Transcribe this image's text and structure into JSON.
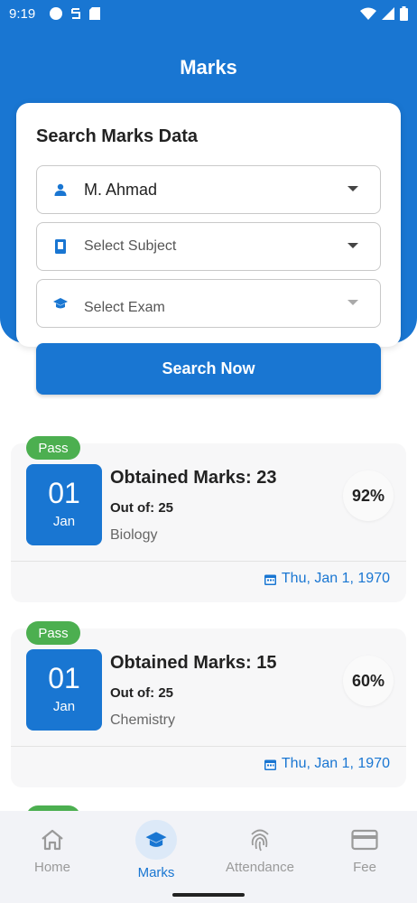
{
  "status_bar": {
    "time": "9:19"
  },
  "header": {
    "title": "Marks"
  },
  "search": {
    "title": "Search Marks Data",
    "student_value": "M. Ahmad",
    "subject_placeholder": "Select Subject",
    "exam_placeholder": "Select Exam",
    "button_label": "Search Now"
  },
  "marks": [
    {
      "status": "Pass",
      "day": "01",
      "month": "Jan",
      "obtained": "Obtained Marks: 23",
      "out_of": "Out of: 25",
      "subject": "Biology",
      "percent": "92%",
      "date": "Thu, Jan 1, 1970"
    },
    {
      "status": "Pass",
      "day": "01",
      "month": "Jan",
      "obtained": "Obtained Marks: 15",
      "out_of": "Out of: 25",
      "subject": "Chemistry",
      "percent": "60%",
      "date": "Thu, Jan 1, 1970"
    }
  ],
  "bottom_nav": {
    "items": [
      {
        "label": "Home",
        "icon": "home-icon"
      },
      {
        "label": "Marks",
        "icon": "graduation-cap-icon"
      },
      {
        "label": "Attendance",
        "icon": "fingerprint-icon"
      },
      {
        "label": "Fee",
        "icon": "credit-card-icon"
      }
    ],
    "active": "Marks"
  },
  "colors": {
    "primary": "#1976d2",
    "pass": "#4caf50"
  }
}
